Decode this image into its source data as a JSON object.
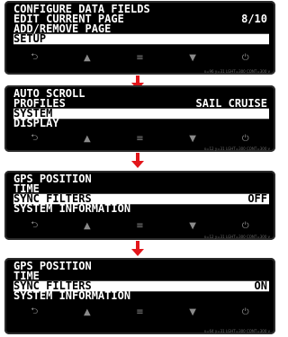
{
  "screens": [
    {
      "rows": [
        {
          "label": "CONFIGURE DATA FIELDS",
          "value": "",
          "selected": false
        },
        {
          "label": "EDIT CURRENT PAGE",
          "value": "8/10",
          "selected": false
        },
        {
          "label": "ADD/REMOVE PAGE",
          "value": "",
          "selected": false
        },
        {
          "label": "SETUP",
          "value": "",
          "selected": true
        }
      ],
      "status": "x=96 y=31   LGHT=300  CONT=300  v"
    },
    {
      "rows": [
        {
          "label": "AUTO SCROLL",
          "value": "",
          "selected": false
        },
        {
          "label": "PROFILES",
          "value": "SAIL CRUISE",
          "selected": false
        },
        {
          "label": "SYSTEM",
          "value": "",
          "selected": true
        },
        {
          "label": "DISPLAY",
          "value": "",
          "selected": false
        }
      ],
      "status": "x=12 y=31   LGHT=300  CONT=300  v"
    },
    {
      "rows": [
        {
          "label": "GPS POSITION",
          "value": "",
          "selected": false
        },
        {
          "label": "TIME",
          "value": "",
          "selected": false
        },
        {
          "label": "SYNC FILTERS",
          "value": "OFF",
          "selected": true
        },
        {
          "label": "SYSTEM INFORMATION",
          "value": "",
          "selected": false
        }
      ],
      "status": "x=12 y=31   LGHT=300  CONT=300  v"
    },
    {
      "rows": [
        {
          "label": "GPS POSITION",
          "value": "",
          "selected": false
        },
        {
          "label": "TIME",
          "value": "",
          "selected": false
        },
        {
          "label": "SYNC FILTERS",
          "value": "ON",
          "selected": true
        },
        {
          "label": "SYSTEM INFORMATION",
          "value": "",
          "selected": false
        }
      ],
      "status": "x=64 y=31   LGHT=300  CONT=300  v"
    }
  ],
  "nav_icons": [
    "back-icon",
    "up-icon",
    "menu-icon",
    "down-icon",
    "power-icon"
  ],
  "nav_glyphs": [
    "⮌",
    "▲",
    "≡",
    "▼",
    "⏻"
  ],
  "colors": {
    "arrow": "#e3161b",
    "screen": "#000000",
    "text": "#ffffff"
  }
}
